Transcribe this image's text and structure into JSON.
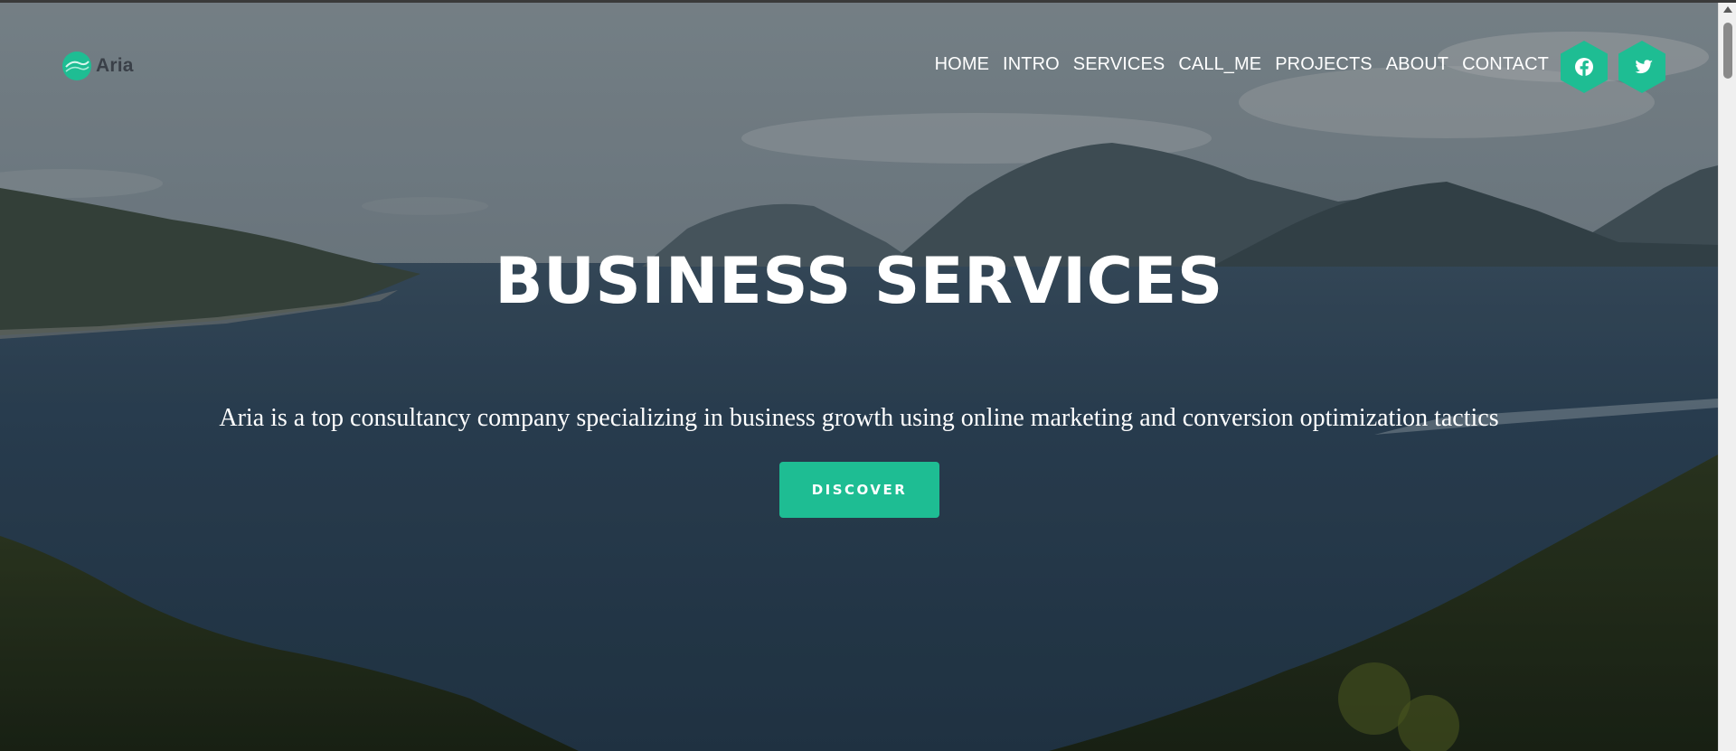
{
  "brand": {
    "name": "Aria",
    "accent": "#1ebd93"
  },
  "nav": {
    "items": [
      {
        "label": "HOME"
      },
      {
        "label": "INTRO"
      },
      {
        "label": "SERVICES"
      },
      {
        "label": "CALL_ME"
      },
      {
        "label": "PROJECTS"
      },
      {
        "label": "ABOUT"
      },
      {
        "label": "CONTACT"
      }
    ],
    "social": [
      {
        "icon": "facebook-icon"
      },
      {
        "icon": "twitter-icon"
      }
    ]
  },
  "hero": {
    "title": "BUSINESS SERVICES",
    "subtitle": "Aria is a top consultancy company specializing in business growth using online marketing and conversion optimization tactics",
    "button_label": "DISCOVER"
  }
}
